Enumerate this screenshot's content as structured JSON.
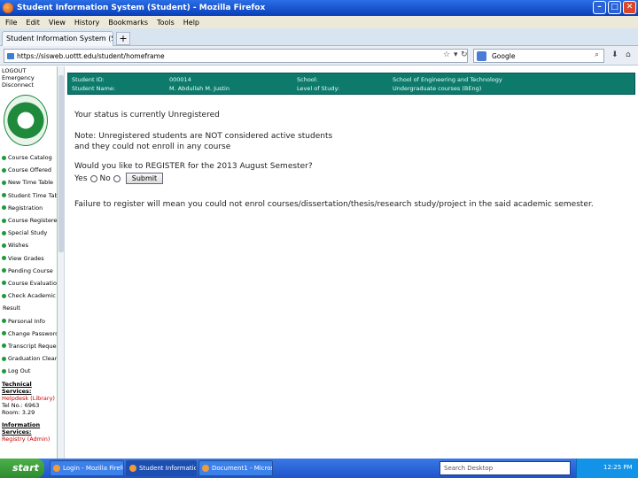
{
  "window": {
    "title": "Student Information System (Student) - Mozilla Firefox"
  },
  "menu": [
    "File",
    "Edit",
    "View",
    "History",
    "Bookmarks",
    "Tools",
    "Help"
  ],
  "tab": {
    "label": "Student Information System (Student)",
    "new": "+"
  },
  "nav": {
    "url": "https://sisweb.uottt.edu/student/homeframe",
    "search_placeholder": "Google"
  },
  "sidebar": {
    "top": [
      "LOGOUT",
      "Emergency",
      "Disconnect"
    ],
    "items": [
      "Course Catalog",
      "Course Offered",
      "New Time Table",
      "Student Time Table",
      "Registration",
      "Course Registered",
      "Special Study",
      "Wishes",
      "View Grades",
      "Pending Course",
      "Course Evaluation",
      "Check Academic",
      "Result",
      "Personal Info",
      "Change Password",
      "Transcript Request",
      "Graduation Clearance",
      "Log Out"
    ],
    "foot": [
      "Technical Services:",
      "Helpdesk (Library)",
      "Tel No.: 6963",
      "Room: 3.29",
      "Information",
      "Services:",
      "Registry (Admin)"
    ]
  },
  "band": {
    "l1": "Student ID:",
    "l2": "Student Name:",
    "v1": "000014",
    "v2": "M. Abdullah M. Justin",
    "l3": "School:",
    "l4": "Level of Study:",
    "v3": "School of Engineering and Technology",
    "v4": "Undergraduate courses (BEng)"
  },
  "main": {
    "status": "Your status is currently Unregistered",
    "note1": "Note: Unregistered students are NOT considered active students",
    "note2": "and they could not enroll in any course",
    "question": "Would you like to REGISTER for the 2013 August Semester?",
    "yes": "Yes",
    "no": "No",
    "submit": "Submit",
    "warning": "Failure to register will mean you could not enrol courses/dissertation/thesis/research study/project in the said academic semester."
  },
  "taskbar": {
    "start": "start",
    "tasks": [
      "Login - Mozilla Firefox",
      "Student Information ...",
      "Document1 - Microsoft ..."
    ],
    "search": "Search Desktop",
    "time": "12:25 PM"
  }
}
